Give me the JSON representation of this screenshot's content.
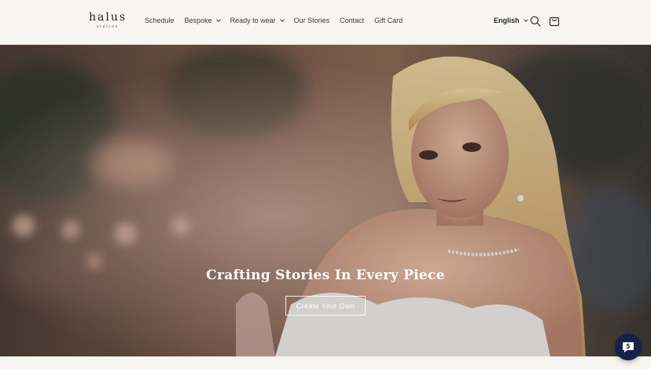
{
  "brand": {
    "logo_main": "halus",
    "logo_sub": "stories"
  },
  "nav": {
    "items": [
      {
        "label": "Schedule",
        "has_dropdown": false
      },
      {
        "label": "Bespoke",
        "has_dropdown": true
      },
      {
        "label": "Ready to wear",
        "has_dropdown": true
      },
      {
        "label": "Our Stories",
        "has_dropdown": false
      },
      {
        "label": "Contact",
        "has_dropdown": false
      },
      {
        "label": "Gift Card",
        "has_dropdown": false
      }
    ]
  },
  "header_actions": {
    "language": "English",
    "search_icon": "search-icon",
    "cart_icon": "cart-icon"
  },
  "hero": {
    "title": "Crafting Stories In Every Piece",
    "button_label": "Create Your Own"
  },
  "chat": {
    "icon": "shopify-chat-icon",
    "color": "#16224a"
  },
  "colors": {
    "header_bg": "#f6f5ef",
    "hero_text": "#ffffff"
  }
}
